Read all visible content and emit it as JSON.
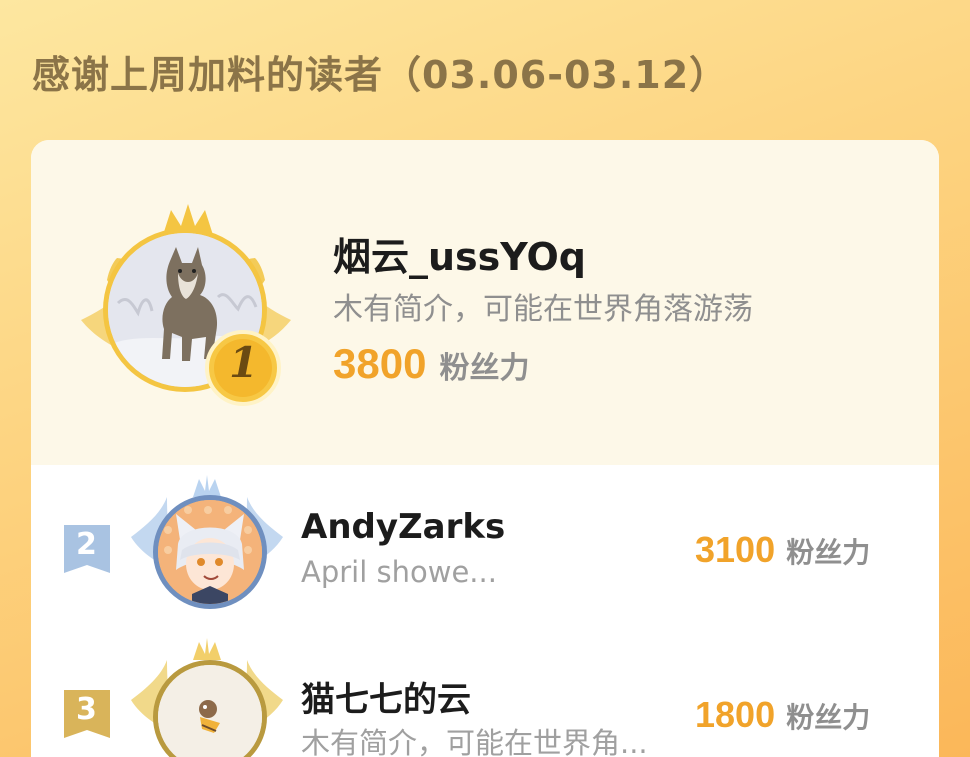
{
  "page": {
    "title": "感谢上周加料的读者（03.06-03.12）"
  },
  "colors": {
    "accent": "#f1a32a",
    "gold": "#f4c542",
    "silver_blue": "#a9c3e2",
    "bronze": "#d9b45a"
  },
  "leaderboard": {
    "top": {
      "rank": "1",
      "name": "烟云_ussYOq",
      "bio": "木有简介，可能在世界角落游荡",
      "score": "3800",
      "unit": "粉丝力"
    },
    "rows": [
      {
        "rank": "2",
        "name": "AndyZarks",
        "bio": "April showe...",
        "score": "3100",
        "unit": "粉丝力"
      },
      {
        "rank": "3",
        "name": "猫七七的云",
        "bio": "木有简介，可能在世界角...",
        "score": "1800",
        "unit": "粉丝力"
      }
    ]
  }
}
